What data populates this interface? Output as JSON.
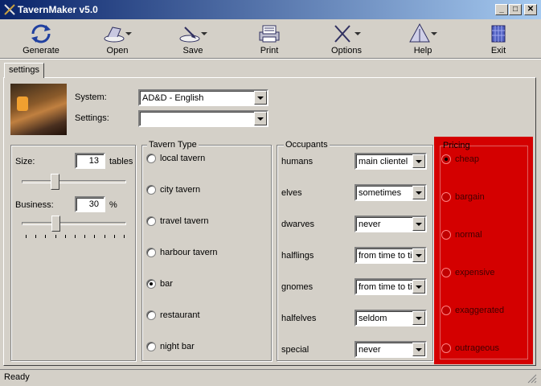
{
  "window": {
    "title": "TavernMaker v5.0",
    "min": "_",
    "max": "□",
    "close": "✕"
  },
  "toolbar": [
    {
      "label": "Generate",
      "icon": "generate-icon"
    },
    {
      "label": "Open",
      "icon": "open-icon"
    },
    {
      "label": "Save",
      "icon": "save-icon"
    },
    {
      "label": "Print",
      "icon": "print-icon"
    },
    {
      "label": "Options",
      "icon": "options-icon"
    },
    {
      "label": "Help",
      "icon": "help-icon"
    },
    {
      "label": "Exit",
      "icon": "exit-icon"
    }
  ],
  "tabs": [
    {
      "label": "settings"
    }
  ],
  "system": {
    "label": "System:",
    "value": "AD&D - English"
  },
  "settings_field": {
    "label": "Settings:",
    "value": ""
  },
  "size": {
    "label": "Size:",
    "value": "13",
    "unit": "tables",
    "slider_level": 0.3
  },
  "business": {
    "label": "Business:",
    "value": "30",
    "unit": "%",
    "slider_level": 0.3
  },
  "tavern_type": {
    "title": "Tavern Type",
    "options": [
      "local tavern",
      "city tavern",
      "travel tavern",
      "harbour tavern",
      "bar",
      "restaurant",
      "night bar"
    ],
    "selected": "bar"
  },
  "occupants": {
    "title": "Occupants",
    "rows": [
      {
        "label": "humans",
        "value": "main clientel"
      },
      {
        "label": "elves",
        "value": "sometimes"
      },
      {
        "label": "dwarves",
        "value": "never"
      },
      {
        "label": "halflings",
        "value": "from time to time"
      },
      {
        "label": "gnomes",
        "value": "from time to time"
      },
      {
        "label": "halfelves",
        "value": "seldom"
      },
      {
        "label": "special",
        "value": "never"
      }
    ]
  },
  "pricing": {
    "title": "Pricing",
    "options": [
      "cheap",
      "bargain",
      "normal",
      "expensive",
      "exaggerated",
      "outrageous"
    ],
    "selected": "cheap",
    "highlight_color": "#d40000"
  },
  "status": {
    "text": "Ready"
  },
  "colors": {
    "titlebar": "#0a246a",
    "face": "#d4d0c8"
  }
}
